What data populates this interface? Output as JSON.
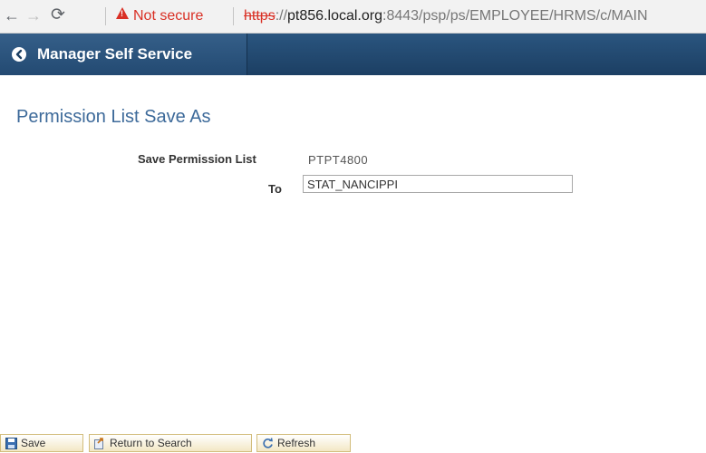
{
  "browser": {
    "security_label": "Not secure",
    "url_scheme": "https",
    "url_separator": "://",
    "url_host": "pt856.local.org",
    "url_rest": ":8443/psp/ps/EMPLOYEE/HRMS/c/MAIN"
  },
  "header": {
    "title": "Manager Self Service"
  },
  "main": {
    "page_title": "Permission List Save As",
    "save_label": "Save Permission List",
    "save_value": "PTPT4800",
    "to_label": "To",
    "to_value": "STAT_NANCIPPI"
  },
  "toolbar": {
    "save_label": "Save",
    "return_label": "Return to Search",
    "refresh_label": "Refresh"
  },
  "colors": {
    "header_bg": "#1c3f63",
    "title_color": "#3d6a9a",
    "warning_red": "#d93025",
    "toolbar_button_bg": "#f3e7c4"
  }
}
